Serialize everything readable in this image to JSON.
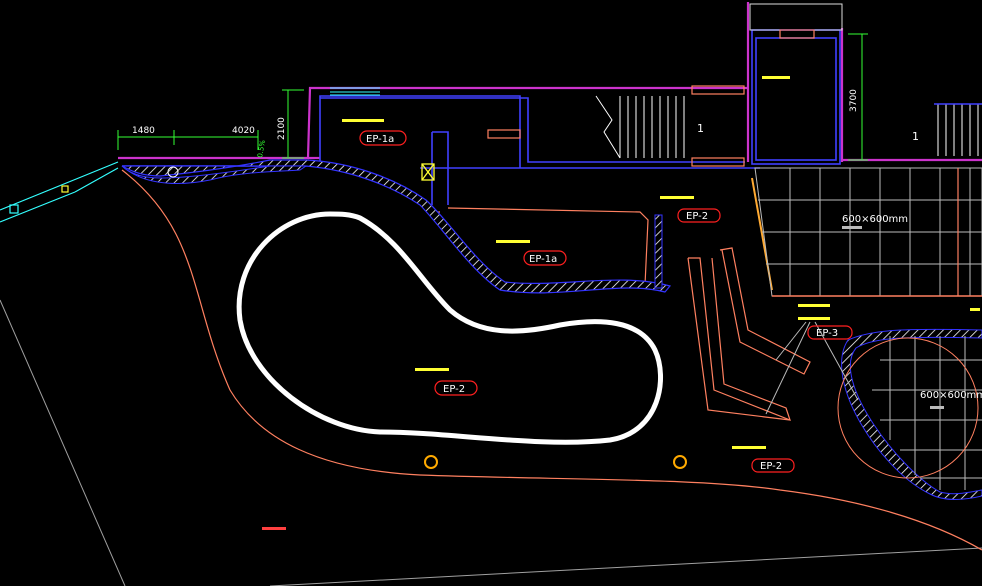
{
  "dimensions": {
    "d1480": "1480",
    "d4020": "4020",
    "d2100": "2100",
    "d3700": "3700",
    "dSlope": "0.5%"
  },
  "tags": {
    "ep1a_top": "EP-1a",
    "ep1a_mid": "EP-1a",
    "ep2_upper": "EP-2",
    "ep2_pool": "EP-2",
    "ep2_lower": "EP-2",
    "ep3": "EP-3"
  },
  "tiles": {
    "upper": "600×600mm",
    "lower": "600×600mm"
  },
  "marks": {
    "stair1": "1",
    "stair2": "1"
  },
  "colors": {
    "background": "#000000",
    "wall": "#3333ff",
    "purple": "#cc33cc",
    "salmon": "#ff8060",
    "tag_border": "#ff2020",
    "grid": "#bbbbbb",
    "dim": "#33ff33",
    "pool": "#ffffff"
  }
}
